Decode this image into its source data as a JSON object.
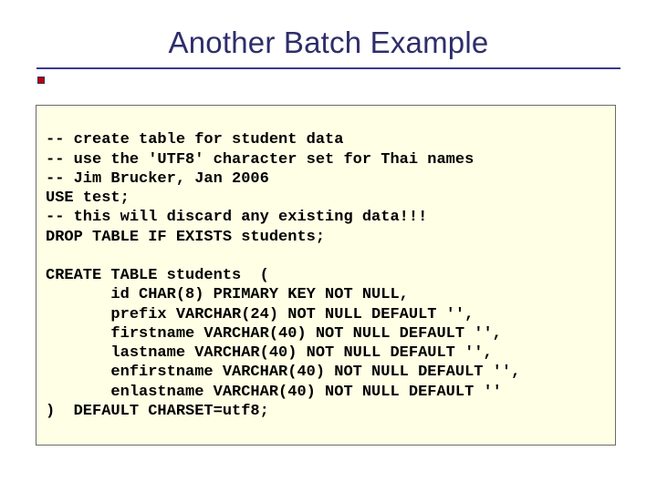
{
  "title": "Another Batch Example",
  "code": [
    "-- create table for student data",
    "-- use the 'UTF8' character set for Thai names",
    "-- Jim Brucker, Jan 2006",
    "USE test;",
    "-- this will discard any existing data!!!",
    "DROP TABLE IF EXISTS students;",
    "",
    "CREATE TABLE students  (",
    "       id CHAR(8) PRIMARY KEY NOT NULL,",
    "       prefix VARCHAR(24) NOT NULL DEFAULT '',",
    "       firstname VARCHAR(40) NOT NULL DEFAULT '',",
    "       lastname VARCHAR(40) NOT NULL DEFAULT '',",
    "       enfirstname VARCHAR(40) NOT NULL DEFAULT '',",
    "       enlastname VARCHAR(40) NOT NULL DEFAULT ''",
    ")  DEFAULT CHARSET=utf8;"
  ]
}
